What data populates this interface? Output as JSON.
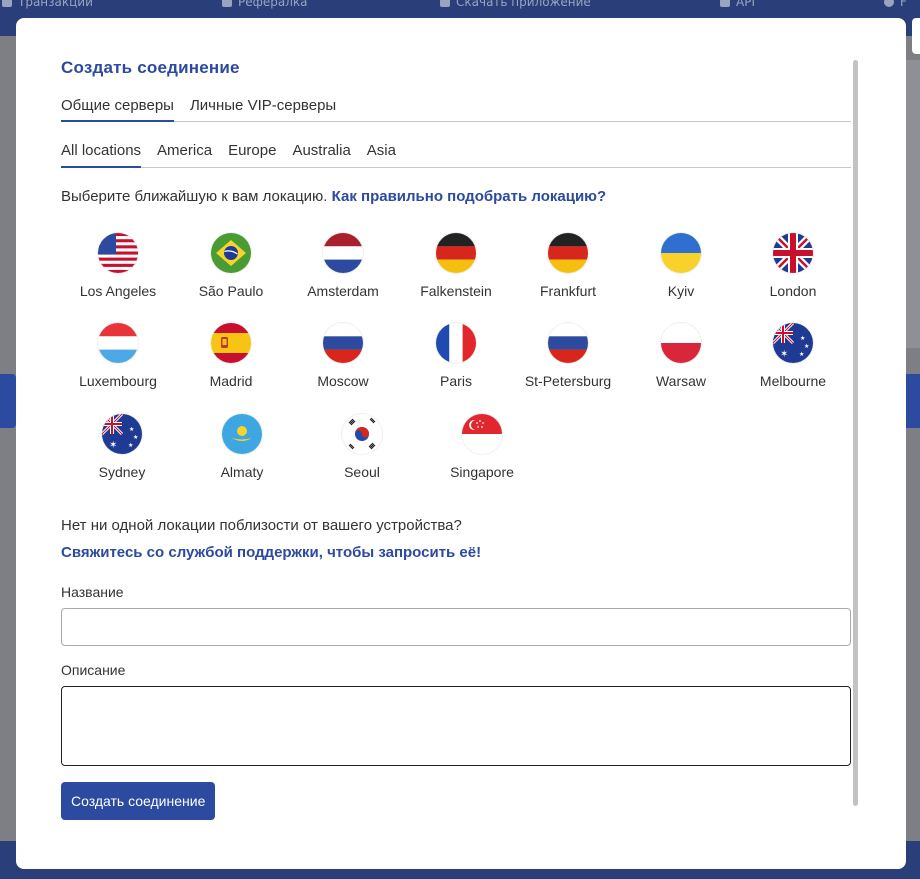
{
  "background": {
    "nav": [
      {
        "label": "Транзакции",
        "icon": "list-icon"
      },
      {
        "label": "Рефералка",
        "icon": "gift-icon"
      },
      {
        "label": "Скачать приложение",
        "icon": "phone-icon"
      },
      {
        "label": "API",
        "icon": "api-icon"
      },
      {
        "label": "F",
        "icon": "help-icon"
      }
    ]
  },
  "modal": {
    "title": "Создать соединение",
    "server_tabs": [
      "Общие серверы",
      "Личные VIP-серверы"
    ],
    "region_tabs": [
      "All locations",
      "America",
      "Europe",
      "Australia",
      "Asia"
    ],
    "hint_text": "Выберите ближайшую к вам локацию. ",
    "hint_link": "Как правильно подобрать локацию?",
    "locations": [
      {
        "name": "Los Angeles",
        "flag": "us-flag-icon"
      },
      {
        "name": "São Paulo",
        "flag": "brazil-flag-icon"
      },
      {
        "name": "Amsterdam",
        "flag": "netherlands-flag-icon"
      },
      {
        "name": "Falkenstein",
        "flag": "germany-flag-icon"
      },
      {
        "name": "Frankfurt",
        "flag": "germany-flag-icon"
      },
      {
        "name": "Kyiv",
        "flag": "ukraine-flag-icon"
      },
      {
        "name": "London",
        "flag": "uk-flag-icon"
      },
      {
        "name": "Luxembourg",
        "flag": "luxembourg-flag-icon"
      },
      {
        "name": "Madrid",
        "flag": "spain-flag-icon"
      },
      {
        "name": "Moscow",
        "flag": "russia-flag-icon"
      },
      {
        "name": "Paris",
        "flag": "france-flag-icon"
      },
      {
        "name": "St-Petersburg",
        "flag": "russia-flag-icon"
      },
      {
        "name": "Warsaw",
        "flag": "poland-flag-icon"
      },
      {
        "name": "Melbourne",
        "flag": "australia-flag-icon"
      },
      {
        "name": "Sydney",
        "flag": "australia-flag-icon"
      },
      {
        "name": "Almaty",
        "flag": "kazakhstan-flag-icon"
      },
      {
        "name": "Seoul",
        "flag": "korea-flag-icon"
      },
      {
        "name": "Singapore",
        "flag": "singapore-flag-icon"
      }
    ],
    "no_location_text": "Нет ни одной локации поблизости от вашего устройства?",
    "support_link": "Свяжитесь со службой поддержки, чтобы запросить её!",
    "name_label": "Название",
    "name_value": "",
    "description_label": "Описание",
    "description_value": "",
    "submit_label": "Создать соединение"
  },
  "colors": {
    "accent": "#2b4aa0",
    "overlay": "#7e7f85",
    "header": "#2a3f7a"
  }
}
